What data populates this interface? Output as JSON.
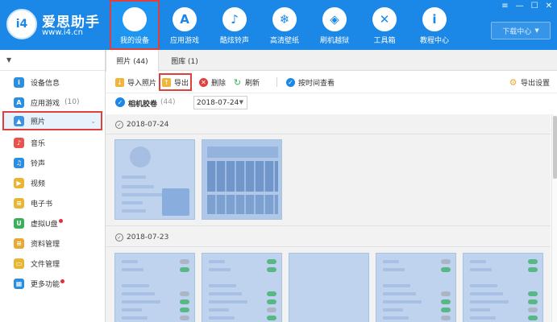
{
  "app": {
    "brand_name": "爱思助手",
    "brand_url": "www.i4.cn",
    "logo_text": "i4",
    "download_center": "下载中心",
    "window_controls": [
      "≡",
      "—",
      "☐",
      "✕"
    ]
  },
  "nav": [
    {
      "label": "我的设备",
      "icon": "apple-icon",
      "glyph": "",
      "active": true
    },
    {
      "label": "应用游戏",
      "icon": "app-store-icon",
      "glyph": "A"
    },
    {
      "label": "酷炫铃声",
      "icon": "bell-icon",
      "glyph": "♪"
    },
    {
      "label": "高清壁纸",
      "icon": "snowflake-icon",
      "glyph": "❄"
    },
    {
      "label": "刷机越狱",
      "icon": "dropbox-icon",
      "glyph": "◈"
    },
    {
      "label": "工具箱",
      "icon": "tools-icon",
      "glyph": "✕"
    },
    {
      "label": "教程中心",
      "icon": "info-icon",
      "glyph": "i"
    }
  ],
  "sidebar": {
    "items": [
      {
        "label": "设备信息",
        "icon": "info-circle-icon",
        "color": "#2a8fe0",
        "glyph": "i"
      },
      {
        "label": "应用游戏",
        "count": "(10)",
        "icon": "app-store-icon",
        "color": "#2a8fe0",
        "glyph": "A"
      },
      {
        "label": "照片",
        "icon": "photo-icon",
        "color": "#3e93de",
        "glyph": "▲",
        "active": true
      },
      {
        "label": "音乐",
        "icon": "music-icon",
        "color": "#e8534d",
        "glyph": "♪"
      },
      {
        "label": "铃声",
        "icon": "bell-icon",
        "color": "#2a8fe0",
        "glyph": "♫"
      },
      {
        "label": "视频",
        "icon": "video-icon",
        "color": "#e9b634",
        "glyph": "▶"
      },
      {
        "label": "电子书",
        "icon": "book-icon",
        "color": "#e9b634",
        "glyph": "≡"
      },
      {
        "label": "虚拟U盘",
        "icon": "usb-icon",
        "color": "#3bb05a",
        "glyph": "U",
        "dot": true
      },
      {
        "label": "资料管理",
        "icon": "document-icon",
        "color": "#e9a834",
        "glyph": "≡"
      },
      {
        "label": "文件管理",
        "icon": "folder-icon",
        "color": "#e9b634",
        "glyph": "▭"
      },
      {
        "label": "更多功能",
        "icon": "grid-icon",
        "color": "#2a8fe0",
        "glyph": "▦",
        "dot": true
      }
    ]
  },
  "tabs": [
    {
      "label": "照片 (44)",
      "active": true
    },
    {
      "label": "图库 (1)"
    }
  ],
  "toolbar": {
    "import": "导入照片",
    "export": "导出",
    "delete": "删除",
    "refresh": "刷新",
    "view_by_time": "按时间查看",
    "export_settings": "导出设置"
  },
  "filter": {
    "album": "相机胶卷",
    "count": "(44)",
    "date": "2018-07-24"
  },
  "groups": [
    {
      "date": "2018-07-24"
    },
    {
      "date": "2018-07-23"
    }
  ]
}
